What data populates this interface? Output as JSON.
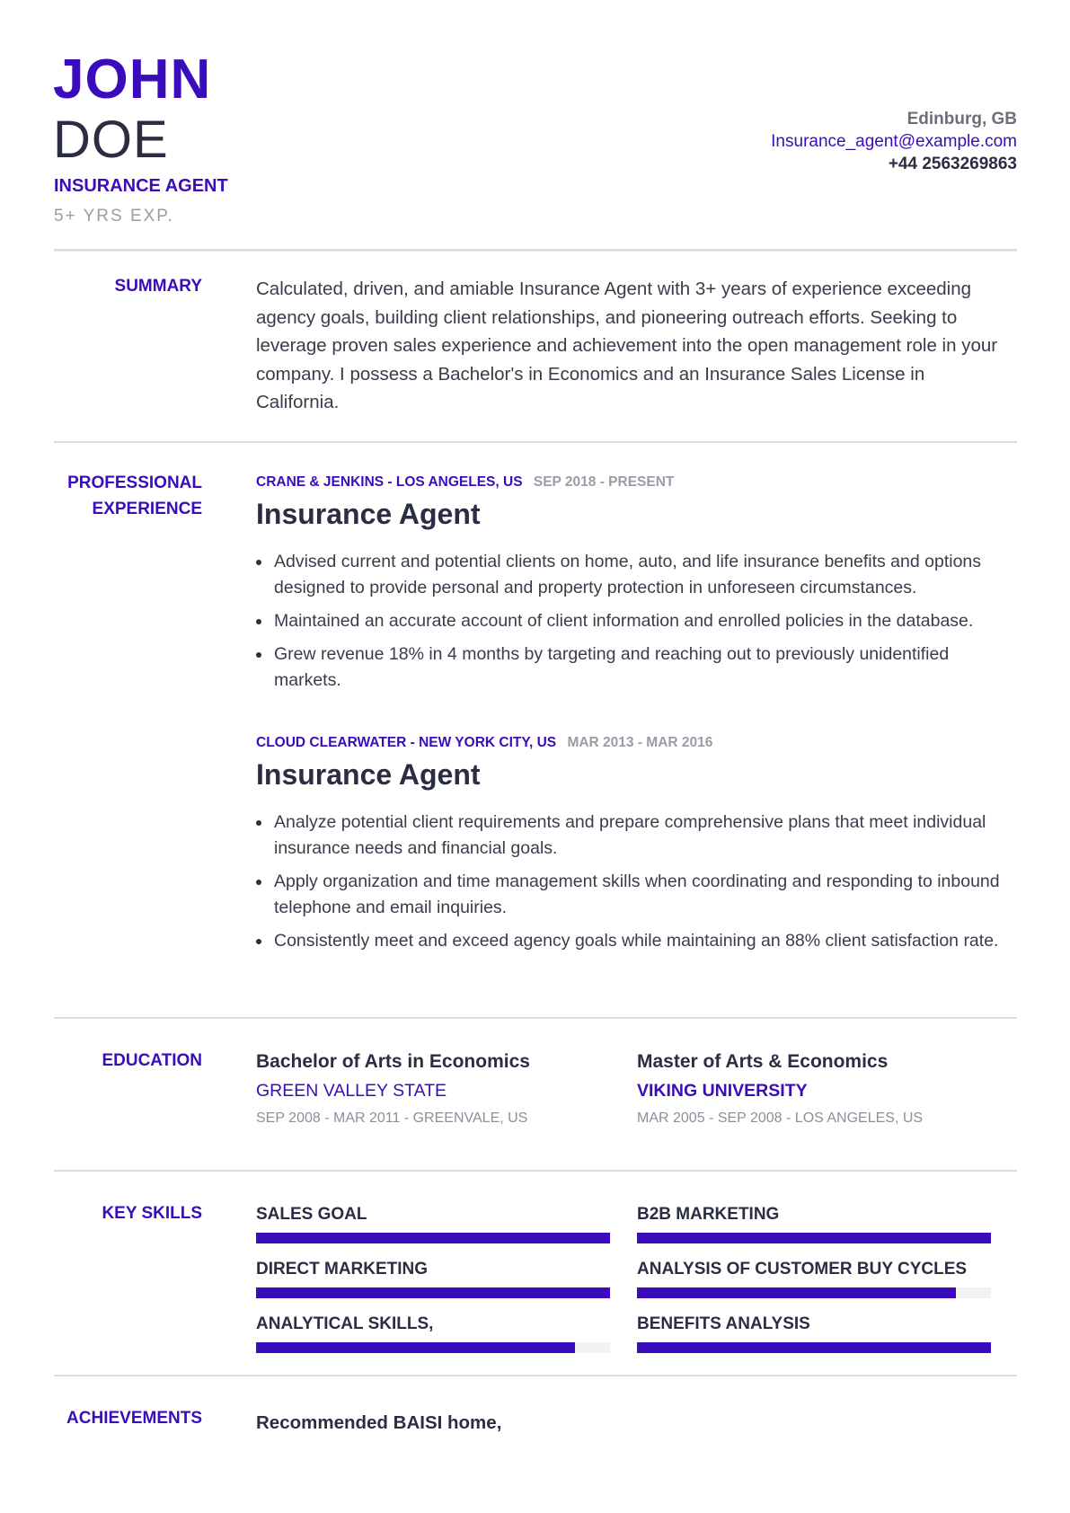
{
  "header": {
    "first_name": "JOHN",
    "last_name": "DOE",
    "job_title": "INSURANCE AGENT",
    "experience": "5+ YRS EXP.",
    "contact": {
      "location": "Edinburg, GB",
      "email": "Insurance_agent@example.com",
      "phone": "+44 2563269863"
    }
  },
  "colors": {
    "accent": "#3a0cbc",
    "text": "#2b2d42",
    "muted": "#8d8f9b",
    "divider": "#d6dce8"
  },
  "summary": {
    "label": "SUMMARY",
    "text": "Calculated, driven, and amiable Insurance Agent with 3+ years of experience exceeding agency goals, building client relationships, and pioneering outreach efforts. Seeking to leverage proven sales experience and achievement into the open management role in your company. I possess a Bachelor's in Economics and an Insurance Sales License in California."
  },
  "experience": {
    "label_line1": "PROFESSIONAL",
    "label_line2": "EXPERIENCE",
    "jobs": [
      {
        "company": "CRANE & JENKINS - LOS ANGELES, US",
        "dates": "SEP 2018 - PRESENT",
        "title": "Insurance Agent",
        "bullets": [
          " Advised current and potential clients on home, auto, and life insurance benefits and options designed to provide personal and property protection in unforeseen circumstances.",
          "Maintained an accurate account of client information and enrolled policies in the database.",
          "Grew revenue 18% in 4 months by targeting and reaching out to previously unidentified markets."
        ]
      },
      {
        "company": "CLOUD CLEARWATER - NEW YORK CITY, US",
        "dates": "MAR 2013 - MAR 2016",
        "title": "Insurance Agent",
        "bullets": [
          " Analyze potential client requirements and prepare comprehensive plans that meet individual insurance needs and financial goals.",
          "Apply organization and time management skills when coordinating and responding to inbound telephone and email inquiries.",
          "Consistently meet and exceed agency goals while maintaining an 88% client satisfaction rate."
        ]
      }
    ]
  },
  "education": {
    "label": "EDUCATION",
    "items": [
      {
        "degree": "Bachelor of Arts in Economics",
        "school": "GREEN VALLEY STATE",
        "meta": "SEP 2008 - MAR 2011 - GREENVALE, US"
      },
      {
        "degree": "Master of Arts & Economics",
        "school": "VIKING UNIVERSITY",
        "meta": "MAR 2005 - SEP 2008 - LOS ANGELES, US"
      }
    ]
  },
  "skills": {
    "label": "KEY SKILLS",
    "items": [
      {
        "name": "SALES GOAL",
        "level_percent": 100
      },
      {
        "name": "B2B MARKETING",
        "level_percent": 100
      },
      {
        "name": "DIRECT MARKETING",
        "level_percent": 100
      },
      {
        "name": "ANALYSIS OF CUSTOMER BUY CYCLES",
        "level_percent": 90
      },
      {
        "name": "ANALYTICAL SKILLS,",
        "level_percent": 90
      },
      {
        "name": "BENEFITS ANALYSIS",
        "level_percent": 100
      }
    ]
  },
  "achievements": {
    "label": "ACHIEVEMENTS",
    "items": [
      "Recommended BAISI home,"
    ]
  }
}
